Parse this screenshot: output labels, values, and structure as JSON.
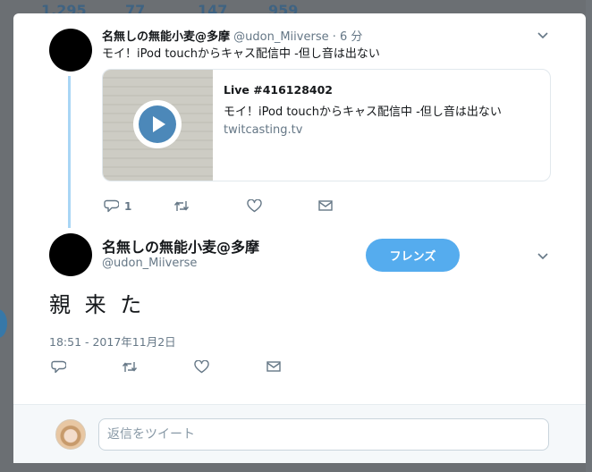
{
  "background": {
    "stats": [
      "1,295",
      "77",
      "147",
      "959"
    ]
  },
  "parent_tweet": {
    "name": "名無しの無能小麦@多摩",
    "handle": "@udon_Miiverse",
    "time": "6 分",
    "separator": "·",
    "text": "モイ！iPod touchからキャス配信中 -但し音は出ない",
    "card": {
      "title": "Live #416128402",
      "description": "モイ！iPod touchからキャス配信中 -但し音は出ない",
      "domain": "twitcasting.tv"
    },
    "reply_count": "1"
  },
  "main_tweet": {
    "name": "名無しの無能小麦@多摩",
    "handle": "@udon_Miiverse",
    "follow_button": "フレンズ",
    "text": "親 来 た",
    "timestamp": "18:51 - 2017年11月2日"
  },
  "reply_box": {
    "placeholder": "返信をツイート"
  },
  "colors": {
    "accent": "#55acee",
    "thread_line": "#a9d6f5",
    "muted": "#657786"
  }
}
